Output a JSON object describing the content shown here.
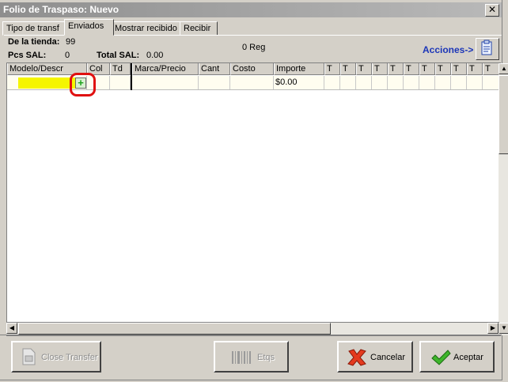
{
  "window": {
    "title": "Folio de Traspaso: Nuevo",
    "close_glyph": "✕"
  },
  "tabs": [
    "Tipo de transf",
    "Enviados",
    "Mostrar recibido",
    "Recibir"
  ],
  "info": {
    "store_label": "De la tienda:",
    "store_value": "99",
    "pcs_label": "Pcs SAL:",
    "pcs_value": "0",
    "total_label": "Total SAL:",
    "total_value": "0.00",
    "reg_count": "0 Reg",
    "acciones": "Acciones->"
  },
  "grid": {
    "columns": [
      "Modelo/Descr",
      "Col",
      "Td",
      "Marca/Precio",
      "Cant",
      "Costo",
      "Importe",
      "T",
      "T",
      "T",
      "T",
      "T",
      "T",
      "T",
      "T",
      "T",
      "T",
      "T"
    ],
    "row": {
      "importe": "$0.00"
    }
  },
  "buttons": {
    "close_transfer": "Close Transfer",
    "etqs": "Etqs",
    "cancelar": "Cancelar",
    "aceptar": "Aceptar"
  },
  "icons": {
    "add": "plus-icon",
    "clipboard": "clipboard-icon",
    "barcode": "barcode-icon",
    "cancel": "red-x-icon",
    "accept": "green-check-icon",
    "transfer": "document-icon"
  },
  "colors": {
    "highlight": "#f5f500",
    "ring": "#e01010",
    "acciones": "#1c36b8"
  }
}
